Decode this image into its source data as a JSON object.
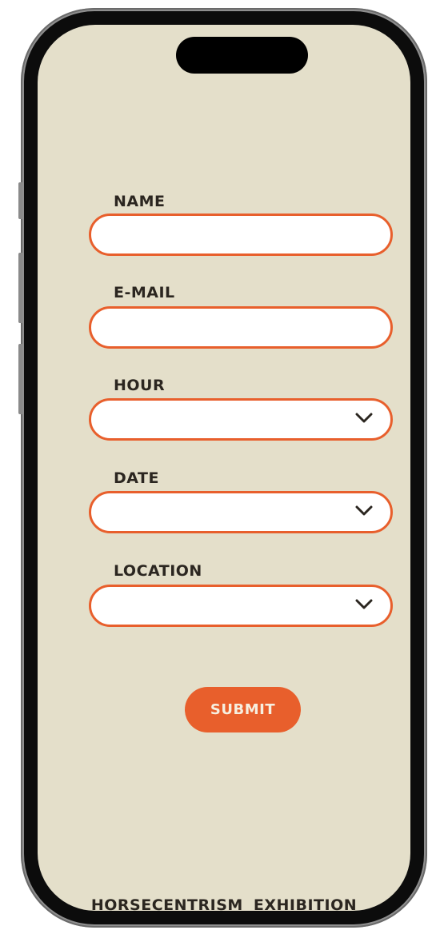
{
  "app": {
    "title": "HORSECENTRISM  EXHIBITION"
  },
  "form": {
    "name": {
      "label": "NAME",
      "value": "",
      "placeholder": ""
    },
    "email": {
      "label": "E-MAIL",
      "value": "",
      "placeholder": ""
    },
    "hour": {
      "label": "HOUR",
      "selected": ""
    },
    "date": {
      "label": "DATE",
      "selected": ""
    },
    "location": {
      "label": "LOCATION",
      "selected": ""
    },
    "submit_label": "SUBMIT"
  },
  "icons": {
    "dropdown": "chevron-down-icon"
  },
  "colors": {
    "accent": "#e85f2c",
    "background": "#e4dfca",
    "text": "#2b2620",
    "field_fill": "#ffffff"
  }
}
